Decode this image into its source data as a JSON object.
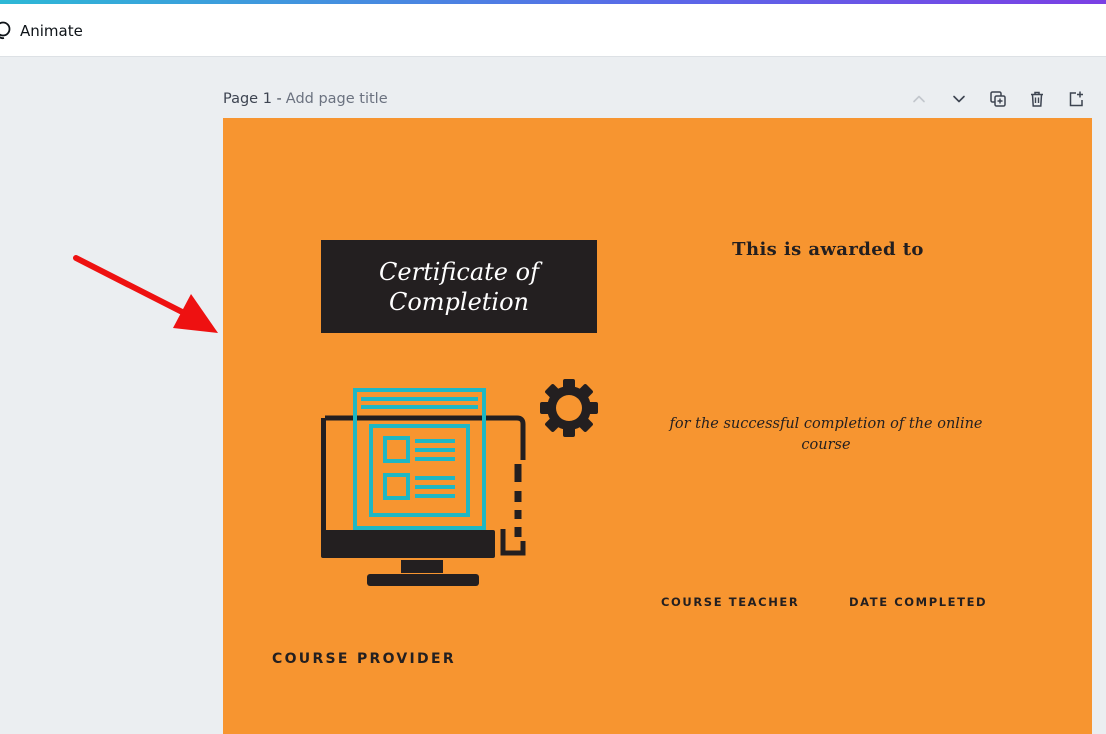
{
  "toolbar": {
    "animate_label": "Animate"
  },
  "page": {
    "number_label": "Page 1 -",
    "title_placeholder": "Add page title",
    "actions": [
      "chevron-up-icon",
      "chevron-down-icon",
      "duplicate-page-icon",
      "delete-page-icon",
      "add-page-icon"
    ]
  },
  "certificate": {
    "title_line1": "Certificate of",
    "title_line2": "Completion",
    "awarded_to": "This is awarded to",
    "completion_text": "for the successful completion of the online course",
    "course_teacher": "COURSE TEACHER",
    "date_completed": "DATE COMPLETED",
    "course_provider": "COURSE PROVIDER"
  },
  "colors": {
    "canvas_bg": "#f79530",
    "dark": "#231f20",
    "teal": "#1fb7c4",
    "arrow": "#ee1111"
  }
}
